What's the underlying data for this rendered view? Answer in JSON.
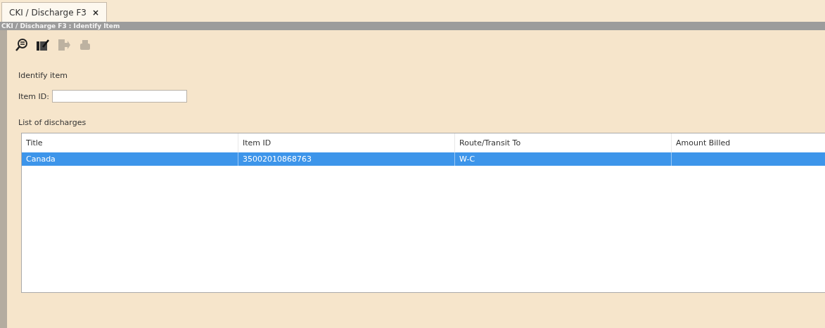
{
  "tabs": [
    {
      "label": "CKI / Discharge F3",
      "close": "×",
      "selected": true
    }
  ],
  "title_bar": {
    "title": "CKI / Discharge F3 : Identify Item"
  },
  "toolbar": [
    {
      "kind": "search",
      "disabled": false
    },
    {
      "kind": "edit",
      "disabled": false
    },
    {
      "kind": "export",
      "disabled": true
    },
    {
      "kind": "print",
      "disabled": true
    }
  ],
  "identify_section": {
    "heading": "Identify item",
    "field_label": "Item ID:"
  },
  "list_section": {
    "heading": "List of discharges"
  },
  "table": {
    "columns": [
      "Title",
      "Item ID",
      "Route/Transit To",
      "Amount Billed"
    ],
    "rows": [
      {
        "cells": [
          "Canada",
          "35002010868763",
          "W-C",
          ""
        ],
        "selected": true
      }
    ]
  }
}
